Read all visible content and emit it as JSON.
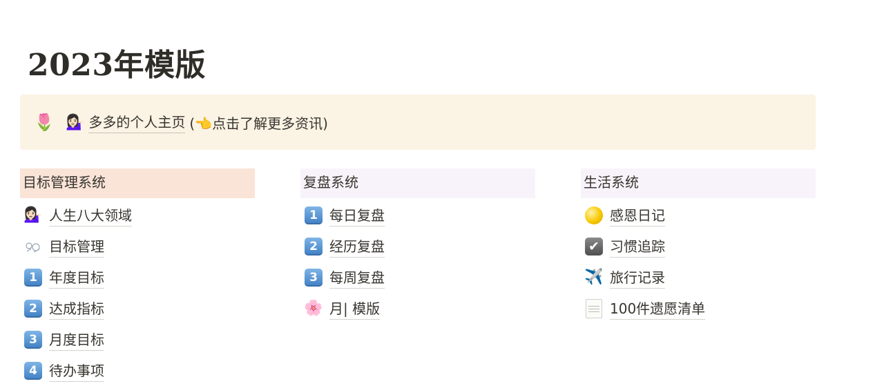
{
  "page": {
    "title": "2023年模版"
  },
  "callout": {
    "icon": "tulip-icon",
    "link": {
      "avatar_icon": "woman-avatar-icon",
      "text": "多多的个人主页",
      "note": "(👈点击了解更多资讯)"
    }
  },
  "columns": [
    {
      "heading": "目标管理系统",
      "heading_bg": "#fae4d7",
      "items": [
        {
          "label": "人生八大领域",
          "icon": "woman-avatar-icon"
        },
        {
          "label": "目标管理",
          "icon": "sketch-flower-icon"
        },
        {
          "label": "年度目标",
          "icon": "keycap-1-icon",
          "glyph": "1"
        },
        {
          "label": "达成指标",
          "icon": "keycap-2-icon",
          "glyph": "2"
        },
        {
          "label": "月度目标",
          "icon": "keycap-3-icon",
          "glyph": "3"
        },
        {
          "label": "待办事项",
          "icon": "keycap-4-icon",
          "glyph": "4"
        }
      ]
    },
    {
      "heading": "复盘系统",
      "heading_bg": "#f8f3fa",
      "items": [
        {
          "label": "每日复盘",
          "icon": "keycap-1-icon",
          "glyph": "1"
        },
        {
          "label": "经历复盘",
          "icon": "keycap-2-icon",
          "glyph": "2"
        },
        {
          "label": "每周复盘",
          "icon": "keycap-3-icon",
          "glyph": "3"
        },
        {
          "label": "月| 模版",
          "icon": "cherry-blossom-icon"
        }
      ]
    },
    {
      "heading": "生活系统",
      "heading_bg": "#f8f3fa",
      "items": [
        {
          "label": "感恩日记",
          "icon": "full-moon-icon"
        },
        {
          "label": "习惯追踪",
          "icon": "check-box-icon",
          "glyph": "✔"
        },
        {
          "label": "旅行记录",
          "icon": "airplane-icon"
        },
        {
          "label": "100件遗愿清单",
          "icon": "memo-pad-icon"
        }
      ]
    }
  ]
}
